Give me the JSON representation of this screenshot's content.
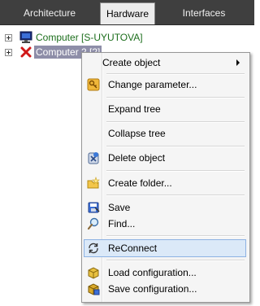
{
  "tabs": [
    {
      "label": "Architecture"
    },
    {
      "label": "Hardware"
    },
    {
      "label": "Interfaces"
    }
  ],
  "tree": [
    {
      "label": "Computer [S-UYUTOVA]",
      "icon": "monitor-icon"
    },
    {
      "label": "Computer 2 [2]",
      "icon": "red-x-icon"
    }
  ],
  "menu": {
    "items": [
      {
        "label": "Create object",
        "icon": "",
        "submenu": true
      },
      {
        "label": "Change parameter...",
        "icon": "key-icon"
      },
      {
        "label": "Expand tree",
        "icon": ""
      },
      {
        "label": "Collapse tree",
        "icon": ""
      },
      {
        "label": "Delete object",
        "icon": "delete-object-icon"
      },
      {
        "label": "Create folder...",
        "icon": "folder-new-icon"
      },
      {
        "label": "Save",
        "icon": "save-icon"
      },
      {
        "label": "Find...",
        "icon": "magnifier-icon"
      },
      {
        "label": "ReConnect",
        "icon": "reconnect-icon",
        "highlighted": true
      },
      {
        "label": "Load configuration...",
        "icon": "load-config-icon"
      },
      {
        "label": "Save configuration...",
        "icon": "save-config-icon"
      }
    ]
  },
  "colors": {
    "tabbar": "#3f3f3f",
    "tree_ok_text": "#1c6e1c",
    "tree_selected_bg": "#8e8ea8",
    "menu_highlight_bg": "#dbe9f8",
    "menu_highlight_border": "#8db2e3"
  }
}
